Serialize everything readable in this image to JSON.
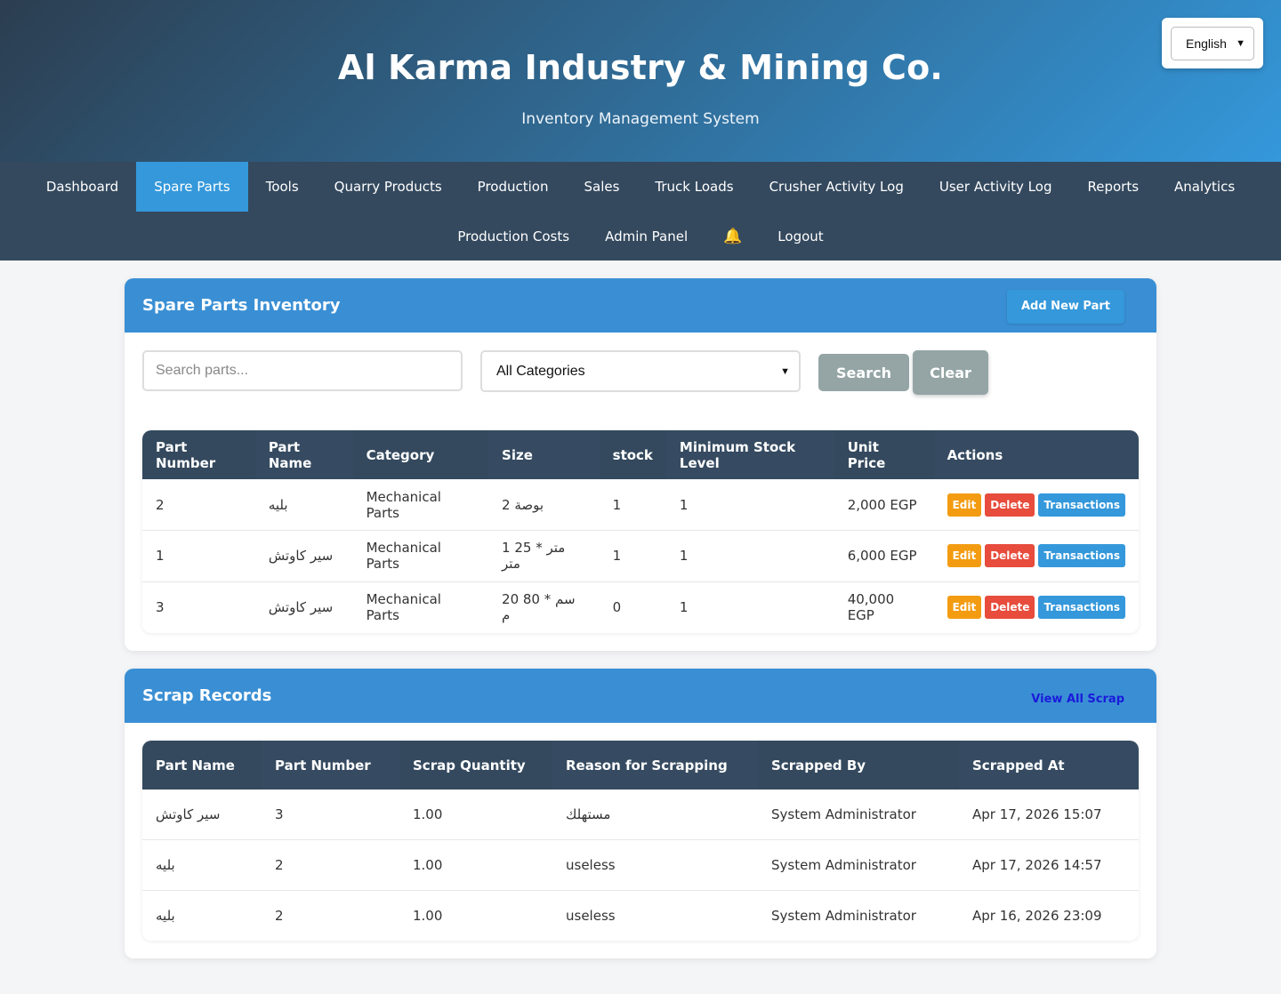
{
  "header": {
    "title": "Al Karma Industry & Mining Co.",
    "subtitle": "Inventory Management System",
    "language": "English"
  },
  "nav": {
    "row1": [
      "Dashboard",
      "Spare Parts",
      "Tools",
      "Quarry Products",
      "Production",
      "Sales",
      "Truck Loads",
      "Crusher Activity Log",
      "User Activity Log",
      "Reports",
      "Analytics"
    ],
    "row2": [
      "Production Costs",
      "Admin Panel"
    ],
    "logout": "Logout",
    "active": "Spare Parts"
  },
  "inventory": {
    "title": "Spare Parts Inventory",
    "add_label": "Add New Part",
    "search_placeholder": "Search parts...",
    "category_selected": "All Categories",
    "search_label": "Search",
    "clear_label": "Clear",
    "columns": [
      "Part Number",
      "Part Name",
      "Category",
      "Size",
      "stock",
      "Minimum Stock Level",
      "Unit Price",
      "Actions"
    ],
    "rows": [
      [
        "2",
        "بليه",
        "Mechanical Parts",
        "2 بوصة",
        "1",
        "1",
        "2,000 EGP"
      ],
      [
        "1",
        "سير كاوتش",
        "Mechanical Parts",
        "1 متر * 25 متر",
        "1",
        "1",
        "6,000 EGP"
      ],
      [
        "3",
        "سير كاوتش",
        "Mechanical Parts",
        "20 سم * 80 م",
        "0",
        "1",
        "40,000 EGP"
      ]
    ],
    "actions": {
      "edit": "Edit",
      "delete": "Delete",
      "transactions": "Transactions"
    }
  },
  "scrap": {
    "title": "Scrap Records",
    "view_all": "View All Scrap",
    "columns": [
      "Part Name",
      "Part Number",
      "Scrap Quantity",
      "Reason for Scrapping",
      "Scrapped By",
      "Scrapped At"
    ],
    "rows": [
      [
        "سير كاوتش",
        "3",
        "1.00",
        "مستهلك",
        "System Administrator",
        "Apr 17, 2026 15:07"
      ],
      [
        "بليه",
        "2",
        "1.00",
        "useless",
        "System Administrator",
        "Apr 17, 2026 14:57"
      ],
      [
        "بليه",
        "2",
        "1.00",
        "useless",
        "System Administrator",
        "Apr 16, 2026 23:09"
      ]
    ]
  }
}
